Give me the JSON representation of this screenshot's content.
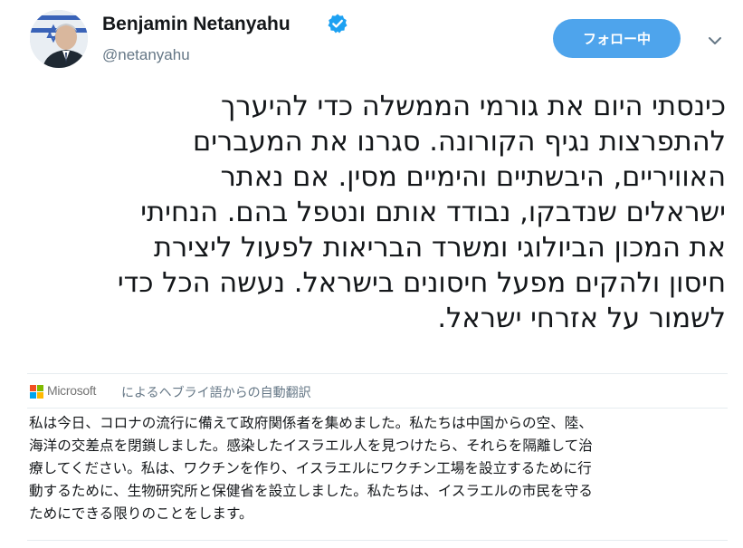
{
  "author": {
    "name": "Benjamin Netanyahu",
    "handle": "@netanyahu",
    "verified": true
  },
  "follow_button": {
    "label": "フォロー中",
    "color": "#4ea4ec"
  },
  "menu_icon": "chevron-down-icon",
  "tweet": {
    "lines": [
      "כינסתי היום את גורמי הממשלה כדי להיערך",
      "להתפרצות נגיף הקורונה. סגרנו את המעברים",
      "האוויריים, היבשתיים והימיים מסין. אם נאתר",
      "ישראלים שנדבקו, נבודד אותם ונטפל בהם. הנחיתי",
      "את המכון הביולוגי ומשרד הבריאות לפעול ליצירת",
      "חיסון ולהקים מפעל חיסונים בישראל. נעשה הכל כדי",
      "לשמור על אזרחי ישראל."
    ]
  },
  "translation": {
    "provider": "Microsoft",
    "label": "によるヘブライ語からの自動翻訳",
    "lines": [
      "私は今日、コロナの流行に備えて政府関係者を集めました。私たちは中国からの空、陸、",
      "海洋の交差点を閉鎖しました。感染したイスラエル人を見つけたら、それらを隔離して治",
      "療してください。私は、ワクチンを作り、イスラエルにワクチン工場を設立するために行",
      "動するために、生物研究所と保健省を設立しました。私たちは、イスラエルの市民を守る",
      "ためにできる限りのことをします。"
    ]
  }
}
